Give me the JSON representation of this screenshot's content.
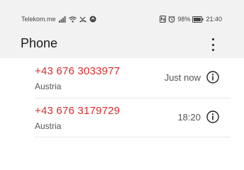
{
  "status_bar": {
    "carrier": "Telekom.me",
    "battery": "98%",
    "time": "21:40"
  },
  "app_bar": {
    "title": "Phone",
    "menu_icon": "more-vert-icon"
  },
  "calls": [
    {
      "number": "+43 676 3033977",
      "country": "Austria",
      "time": "Just now",
      "info_icon": "info-icon"
    },
    {
      "number": "+43 676 3179729",
      "country": "Austria",
      "time": "18:20",
      "info_icon": "info-icon"
    }
  ],
  "colors": {
    "number": "#d32f2f",
    "bar_background": "#f2f2f2"
  }
}
